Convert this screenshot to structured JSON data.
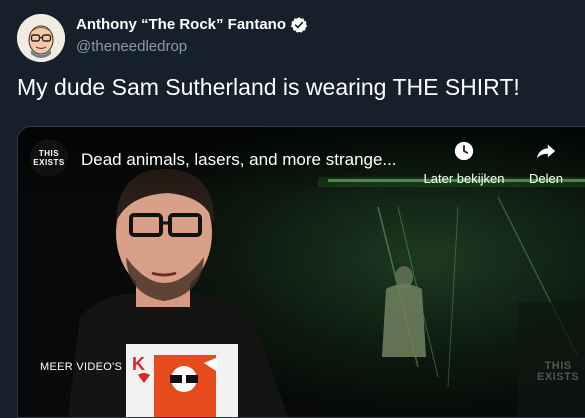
{
  "tweet": {
    "author_name": "Anthony “The Rock” Fantano",
    "author_handle": "@theneedledrop",
    "text": "My dude Sam Sutherland is wearing THE SHIRT!"
  },
  "video": {
    "channel_logo_line1": "THIS",
    "channel_logo_line2": "EXISTS",
    "title": "Dead animals, lasers, and more strange...",
    "watch_later_label": "Later bekijken",
    "share_label": "Delen",
    "more_videos_label": "MEER VIDEO'S",
    "watermark_line1": "THIS",
    "watermark_line2": "EXISTS"
  },
  "icons": {
    "avatar": "avatar-illustration",
    "verified": "verified-badge-icon",
    "watch_later": "clock-icon",
    "share": "share-arrow-icon"
  },
  "colors": {
    "background": "#15202b",
    "text_primary": "#ffffff",
    "text_secondary": "#8899a6",
    "verified": "#ffffff"
  }
}
